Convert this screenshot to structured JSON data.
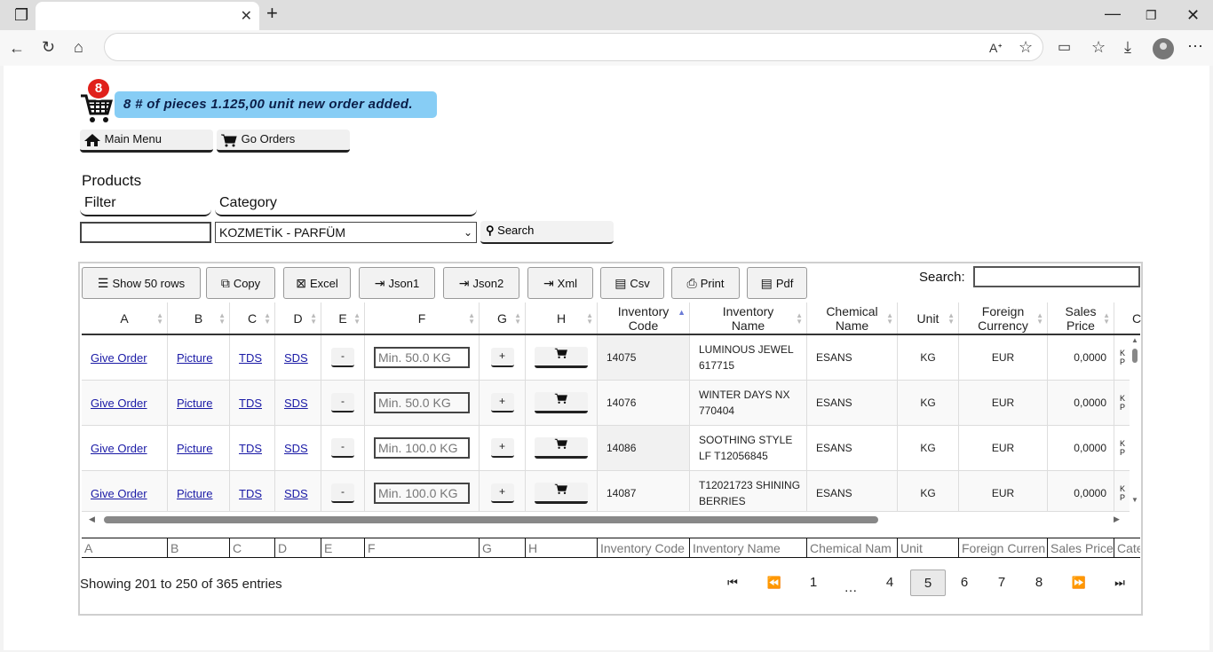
{
  "cart": {
    "count": "8",
    "message": "8 # of pieces 1.125,00 unit new order added."
  },
  "nav": {
    "main_menu": "Main Menu",
    "go_orders": "Go Orders"
  },
  "products": {
    "title": "Products",
    "filter_label": "Filter",
    "category_label": "Category",
    "category_value": "KOZMETİK - PARFÜM",
    "search_button": "Search"
  },
  "toolbar": {
    "show_rows": "Show 50 rows",
    "copy": "Copy",
    "excel": "Excel",
    "json1": "Json1",
    "json2": "Json2",
    "xml": "Xml",
    "csv": "Csv",
    "print": "Print",
    "pdf": "Pdf",
    "search_label": "Search:"
  },
  "columns": [
    "A",
    "B",
    "C",
    "D",
    "E",
    "F",
    "G",
    "H",
    "Inventory Code",
    "Inventory Name",
    "Chemical Name",
    "Unit",
    "Foreign Currency",
    "Sales Price",
    "C"
  ],
  "footer_columns": [
    "A",
    "B",
    "C",
    "D",
    "E",
    "F",
    "G",
    "H",
    "Inventory Code",
    "Inventory Name",
    "Chemical Nam",
    "Unit",
    "Foreign Curren",
    "Sales Price",
    "Cate"
  ],
  "rows": [
    {
      "a": "Give Order",
      "b": "Picture",
      "c": "TDS",
      "d": "SDS",
      "e": "-",
      "f": "Min. 50.0 KG",
      "g": "+",
      "code": "14075",
      "name": "LUMINOUS JEWEL 617715",
      "chem": "ESANS",
      "unit": "KG",
      "cur": "EUR",
      "price": "0,0000",
      "c2": "K P"
    },
    {
      "a": "Give Order",
      "b": "Picture",
      "c": "TDS",
      "d": "SDS",
      "e": "-",
      "f": "Min. 50.0 KG",
      "g": "+",
      "code": "14076",
      "name": "WINTER DAYS NX 770404",
      "chem": "ESANS",
      "unit": "KG",
      "cur": "EUR",
      "price": "0,0000",
      "c2": "K P"
    },
    {
      "a": "Give Order",
      "b": "Picture",
      "c": "TDS",
      "d": "SDS",
      "e": "-",
      "f": "Min. 100.0 KG",
      "g": "+",
      "code": "14086",
      "name": "SOOTHING STYLE LF T12056845",
      "chem": "ESANS",
      "unit": "KG",
      "cur": "EUR",
      "price": "0,0000",
      "c2": "K P"
    },
    {
      "a": "Give Order",
      "b": "Picture",
      "c": "TDS",
      "d": "SDS",
      "e": "-",
      "f": "Min. 100.0 KG",
      "g": "+",
      "code": "14087",
      "name": "T12021723 SHINING BERRIES",
      "chem": "ESANS",
      "unit": "KG",
      "cur": "EUR",
      "price": "0,0000",
      "c2": "K P"
    }
  ],
  "info": "Showing 201 to 250 of 365 entries",
  "pagination": {
    "first": "⏮",
    "prev": "⏪",
    "pages": [
      "1",
      "…",
      "4",
      "5",
      "6",
      "7",
      "8"
    ],
    "current": "5",
    "next": "⏩",
    "last": "⏭"
  }
}
